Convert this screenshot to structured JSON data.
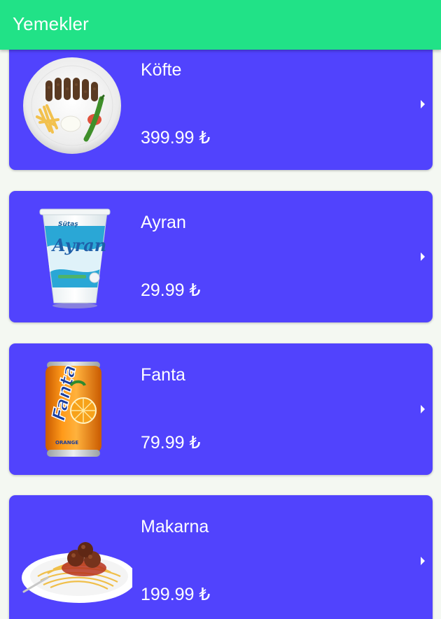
{
  "app_bar": {
    "title": "Yemekler"
  },
  "items": [
    {
      "name": "Köfte",
      "price": "399.99 ₺",
      "image_icon": "kofte-plate-image"
    },
    {
      "name": "Ayran",
      "price": "29.99 ₺",
      "image_icon": "ayran-cup-image",
      "image_text": [
        "Sütaş",
        "Ayran"
      ]
    },
    {
      "name": "Fanta",
      "price": "79.99 ₺",
      "image_icon": "fanta-can-image",
      "image_text": [
        "Fanta",
        "ORANGE"
      ]
    },
    {
      "name": "Makarna",
      "price": "199.99 ₺",
      "image_icon": "spaghetti-plate-image"
    }
  ],
  "colors": {
    "app_bar": "#21e287",
    "card": "#5143fd",
    "background": "#f4f8f2",
    "text": "#ffffff"
  }
}
